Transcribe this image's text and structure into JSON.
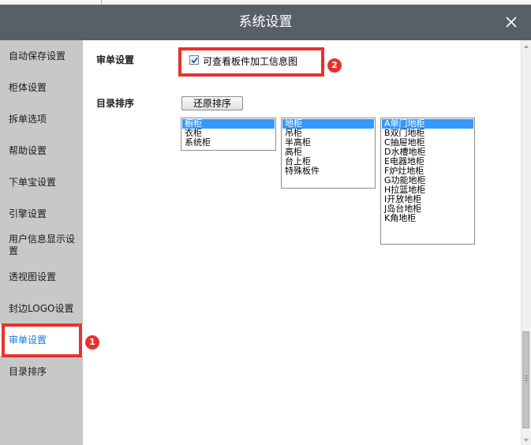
{
  "window": {
    "title": "系统设置",
    "close_icon": "close-icon"
  },
  "sidebar": {
    "items": [
      {
        "label": "自动保存设置",
        "active": false
      },
      {
        "label": "柜体设置",
        "active": false
      },
      {
        "label": "拆单选项",
        "active": false
      },
      {
        "label": "帮助设置",
        "active": false
      },
      {
        "label": "下单宝设置",
        "active": false
      },
      {
        "label": "引擎设置",
        "active": false
      },
      {
        "label": "用户信息显示设置",
        "active": false
      },
      {
        "label": "透视图设置",
        "active": false
      },
      {
        "label": "封边LOGO设置",
        "active": false
      },
      {
        "label": "审单设置",
        "active": true
      },
      {
        "label": "目录排序",
        "active": false
      }
    ]
  },
  "main": {
    "review_section": {
      "label": "审单设置",
      "checkbox_label": "可查看板件加工信息图",
      "checked": true
    },
    "catalog_section": {
      "label": "目录排序",
      "restore_button": "还原排序",
      "lists": [
        {
          "items": [
            "橱柜",
            "衣柜",
            "系统柜"
          ],
          "selected": 0
        },
        {
          "items": [
            "地柜",
            "吊柜",
            "半高柜",
            "高柜",
            "台上柜",
            "特殊板件"
          ],
          "selected": 0
        },
        {
          "items": [
            "A单门地柜",
            "B双门地柜",
            "C抽屉地柜",
            "D水槽地柜",
            "E电器地柜",
            "F炉灶地柜",
            "G功能地柜",
            "H拉篮地柜",
            "I开放地柜",
            "J岛台地柜",
            "K角地柜"
          ],
          "selected": 0
        }
      ]
    }
  },
  "annotations": {
    "marker_1": "1",
    "marker_2": "2",
    "highlight_color": "#e8312f"
  },
  "colors": {
    "titlebar": "#585f67",
    "sidebar_bg": "#c8c8c8",
    "active_text": "#1678d6",
    "list_selection": "#3399ff"
  }
}
